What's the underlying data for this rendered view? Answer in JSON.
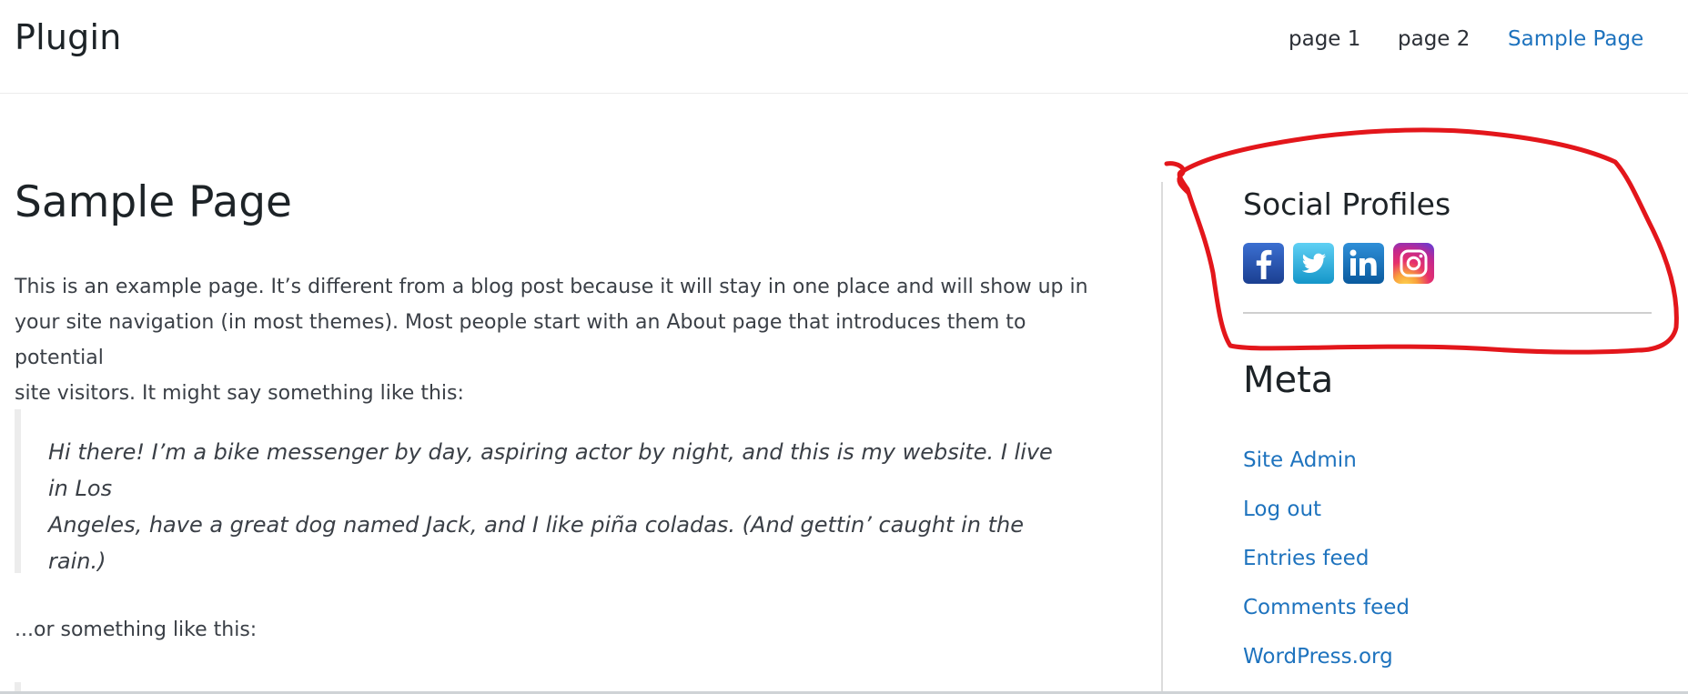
{
  "header": {
    "site_title": "Plugin",
    "nav": [
      {
        "label": "page 1",
        "current": false
      },
      {
        "label": "page 2",
        "current": false
      },
      {
        "label": "Sample Page",
        "current": true
      }
    ]
  },
  "main": {
    "title": "Sample Page",
    "paragraph_1_lines": [
      "This is an example page. It’s different from a blog post because it will stay in one place and will show up in",
      "your site navigation (in most themes). Most people start with an About page that introduces them to potential",
      "site visitors. It might say something like this:"
    ],
    "quote_lines": [
      "Hi there! I’m a bike messenger by day, aspiring actor by night, and this is my website. I live in Los",
      "Angeles, have a great dog named Jack, and I like piña coladas. (And gettin’ caught in the rain.)"
    ],
    "paragraph_2": "...or something like this:"
  },
  "sidebar": {
    "social": {
      "title": "Social Profiles",
      "icons": [
        {
          "name": "facebook-icon",
          "glyph": "f",
          "color": "#1877f2"
        },
        {
          "name": "twitter-icon",
          "glyph": "bird",
          "color": "#1da1f2"
        },
        {
          "name": "linkedin-icon",
          "glyph": "in",
          "color": "#0a66c2"
        },
        {
          "name": "instagram-icon",
          "glyph": "camera",
          "color": "#e1306c"
        }
      ]
    },
    "meta": {
      "title": "Meta",
      "links": [
        "Site Admin",
        "Log out",
        "Entries feed",
        "Comments feed",
        "WordPress.org"
      ]
    }
  },
  "colors": {
    "link": "#1e73be",
    "heading": "#1d2327",
    "annotation": "#e3161b"
  }
}
